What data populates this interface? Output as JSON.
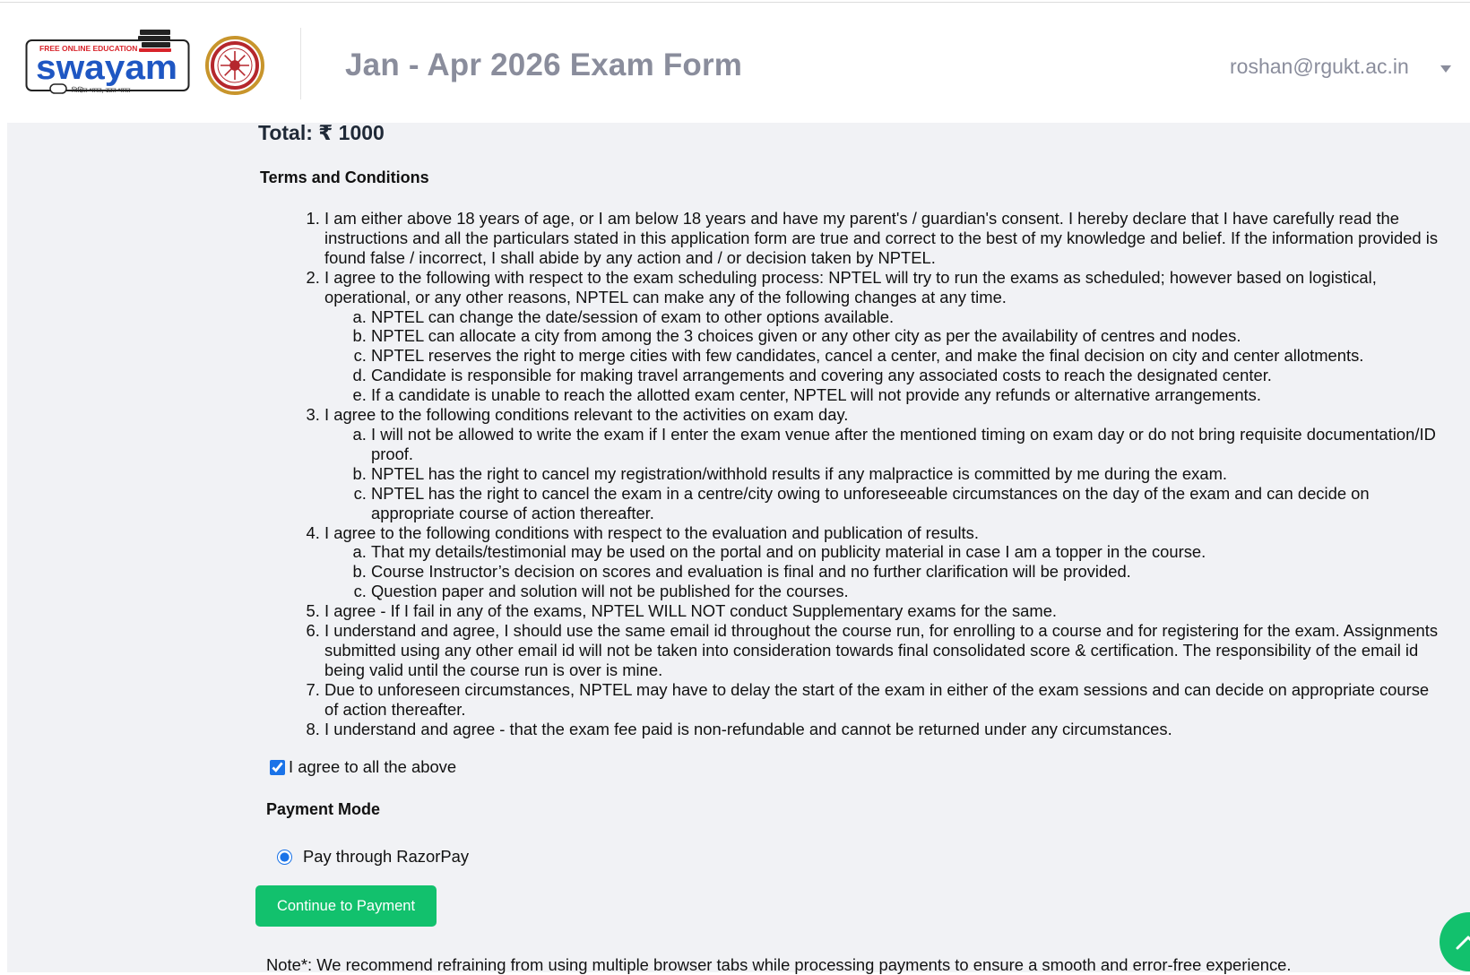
{
  "header": {
    "logo_tagline": "FREE ONLINE EDUCATION",
    "logo_name": "swayam",
    "logo_hindi": "शिक्षित भारत, उन्नत भारत",
    "title": "Jan - Apr 2026 Exam Form",
    "user_email": "roshan@rgukt.ac.in"
  },
  "total": {
    "label": "Total: ₹ 1000"
  },
  "terms": {
    "heading": "Terms and Conditions",
    "items": [
      {
        "text": "I am either above 18 years of age, or I am below 18 years and have my parent's / guardian's consent. I hereby declare that I have carefully read the instructions and all the particulars stated in this application form are true and correct to the best of my knowledge and belief. If the information provided is found false / incorrect, I shall abide by any action and / or decision taken by NPTEL.",
        "sub": []
      },
      {
        "text": "I agree to the following with respect to the exam scheduling process: NPTEL will try to run the exams as scheduled; however based on logistical, operational, or any other reasons, NPTEL can make any of the following changes at any time.",
        "sub": [
          "NPTEL can change the date/session of exam to other options available.",
          "NPTEL can allocate a city from among the 3 choices given or any other city as per the availability of centres and nodes.",
          "NPTEL reserves the right to merge cities with few candidates, cancel a center, and make the final decision on city and center allotments.",
          "Candidate is responsible for making travel arrangements and covering any associated costs to reach the designated center.",
          "If a candidate is unable to reach the allotted exam center, NPTEL will not provide any refunds or alternative arrangements."
        ]
      },
      {
        "text": "I agree to the following conditions relevant to the activities on exam day.",
        "sub": [
          "I will not be allowed to write the exam if I enter the exam venue after the mentioned timing on exam day or do not bring requisite documentation/ID proof.",
          "NPTEL has the right to cancel my registration/withhold results if any malpractice is committed by me during the exam.",
          "NPTEL has the right to cancel the exam in a centre/city owing to unforeseeable circumstances on the day of the exam and can decide on appropriate course of action thereafter."
        ]
      },
      {
        "text": "I agree to the following conditions with respect to the evaluation and publication of results.",
        "sub": [
          "That my details/testimonial may be used on the portal and on publicity material in case I am a topper in the course.",
          "Course Instructor’s decision on scores and evaluation is final and no further clarification will be provided.",
          "Question paper and solution will not be published for the courses."
        ]
      },
      {
        "text": "I agree - If I fail in any of the exams, NPTEL WILL NOT conduct Supplementary exams for the same.",
        "sub": []
      },
      {
        "text": "I understand and agree, I should use the same email id throughout the course run, for enrolling to a course and for registering for the exam. Assignments submitted using any other email id will not be taken into consideration towards final consolidated score & certification. The responsibility of the email id being valid until the course run is over is mine.",
        "sub": []
      },
      {
        "text": "Due to unforeseen circumstances, NPTEL may have to delay the start of the exam in either of the exam sessions and can decide on appropriate course of action thereafter.",
        "sub": []
      },
      {
        "text": "I understand and agree - that the exam fee paid is non-refundable and cannot be returned under any circumstances.",
        "sub": []
      }
    ],
    "agree_label": "I agree to all the above"
  },
  "payment": {
    "heading": "Payment Mode",
    "option_label": "Pay through RazorPay",
    "continue_label": "Continue to Payment"
  },
  "note": {
    "text": "Note*: We recommend refraining from using multiple browser tabs while processing payments to ensure a smooth and error-free experience."
  },
  "colors": {
    "accent_green": "#12c16d",
    "title_gray": "#8a8d9c",
    "main_bg": "#f1f2f5",
    "logo_blue": "#1f57c3",
    "logo_red": "#d8232a"
  },
  "icons": {
    "scroll_top": "chevron-up-icon",
    "user_menu": "caret-down-icon"
  }
}
